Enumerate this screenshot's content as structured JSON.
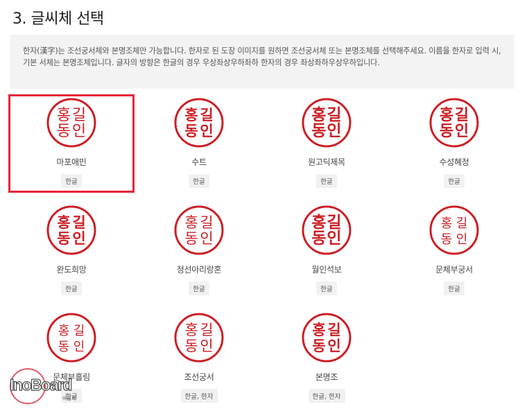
{
  "section": {
    "title": "3. 글씨체 선택",
    "description": "한자(漢字)는 조선궁서체와 본명조체만 가능합니다. 한자로 된 도장 이미지를 원하면 조선궁서체 또는 본명조체를 선택해주세요. 이름을 한자로 입력 시, 기본 서체는 본명조체입니다. 글자의 방향은 한글의 경우 우상좌상우하좌하 한자의 경우 좌상좌하우상우하입니다."
  },
  "stamp_chars": [
    "홍",
    "길",
    "동",
    "인"
  ],
  "accent_color": "#cc1f26",
  "selection_color": "#e8243a",
  "fonts": [
    {
      "name": "마포애민",
      "tag": "한글",
      "selected": true
    },
    {
      "name": "수트",
      "tag": "한글",
      "selected": false
    },
    {
      "name": "원고딕제목",
      "tag": "한글",
      "selected": false
    },
    {
      "name": "수성혜정",
      "tag": "한글",
      "selected": false
    },
    {
      "name": "완도희망",
      "tag": "한글",
      "selected": false
    },
    {
      "name": "정선아리랑혼",
      "tag": "한글",
      "selected": false
    },
    {
      "name": "월인석보",
      "tag": "한글",
      "selected": false
    },
    {
      "name": "문체부궁서",
      "tag": "한글",
      "selected": false
    },
    {
      "name": "문체부흘림",
      "tag": "한글",
      "selected": false
    },
    {
      "name": "조선궁서",
      "tag": "한글, 한자",
      "selected": false
    },
    {
      "name": "본명조",
      "tag": "한글, 한자",
      "selected": false
    }
  ],
  "watermark": {
    "text": "InoBoard",
    "sub": "마음치"
  }
}
